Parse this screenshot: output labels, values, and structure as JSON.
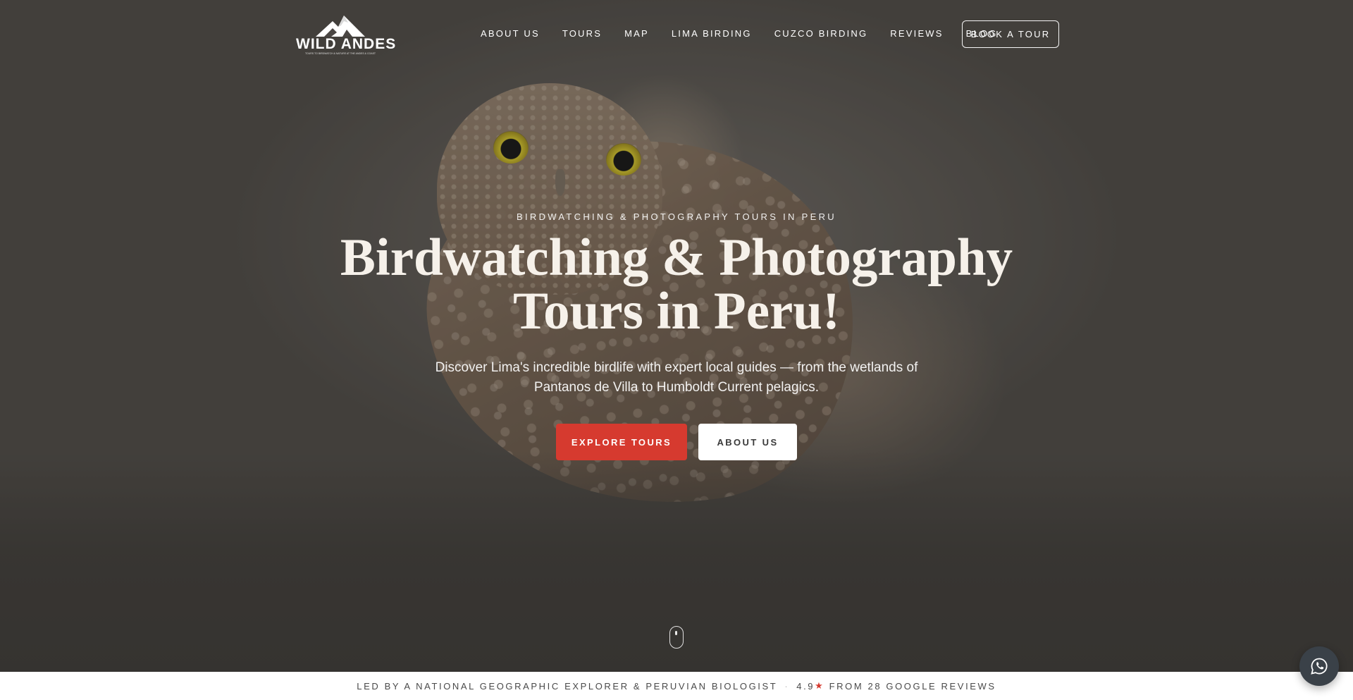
{
  "brand": {
    "name": "WILD ANDES",
    "tagline": "TOURS TO BIRDWATCH & NATURE AT THE ANDES & COAST"
  },
  "nav": {
    "items": [
      {
        "label": "ABOUT US"
      },
      {
        "label": "TOURS"
      },
      {
        "label": "MAP"
      },
      {
        "label": "LIMA BIRDING"
      },
      {
        "label": "CUZCO BIRDING"
      },
      {
        "label": "REVIEWS"
      },
      {
        "label": "BLOG"
      }
    ],
    "cta_label": "BOOK A TOUR"
  },
  "hero": {
    "eyebrow": "BIRDWATCHING & PHOTOGRAPHY TOURS IN PERU",
    "headline_line1": "Birdwatching & Photography",
    "headline_line2": "Tours in Peru!",
    "subtitle": "Discover Lima's incredible birdlife with expert local guides — from the wetlands of Pantanos de Villa to Humboldt Current pelagics.",
    "primary_label": "EXPLORE TOURS",
    "secondary_label": "ABOUT US"
  },
  "trust_bar": {
    "credential": "LED BY A NATIONAL GEOGRAPHIC EXPLORER & PERUVIAN BIOLOGIST",
    "separator": "·",
    "rating": "4.9",
    "star": "★",
    "reviews": "FROM 28 GOOGLE REVIEWS"
  },
  "icons": {
    "scroll": "mouse-scroll-icon",
    "chat": "whatsapp-icon",
    "logo": "mountain-logo-icon"
  },
  "colors": {
    "accent": "#d63a2f",
    "chat_button": "#3a4148",
    "headline": "#f6f1ea"
  }
}
